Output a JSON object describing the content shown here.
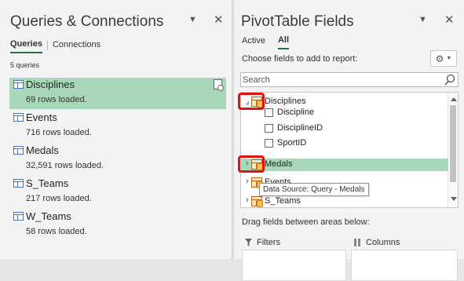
{
  "queries_pane": {
    "title": "Queries & Connections",
    "tabs": [
      "Queries",
      "Connections"
    ],
    "active_tab": "Queries",
    "count_label": "5 queries",
    "items": [
      {
        "name": "Disciplines",
        "rows": "69 rows loaded.",
        "selected": true
      },
      {
        "name": "Events",
        "rows": "716 rows loaded.",
        "selected": false
      },
      {
        "name": "Medals",
        "rows": "32,591 rows loaded.",
        "selected": false
      },
      {
        "name": "S_Teams",
        "rows": "217 rows loaded.",
        "selected": false
      },
      {
        "name": "W_Teams",
        "rows": "58 rows loaded.",
        "selected": false
      }
    ]
  },
  "pivot_pane": {
    "title": "PivotTable Fields",
    "tabs": [
      "Active",
      "All"
    ],
    "active_tab": "All",
    "choose_label": "Choose fields to add to report:",
    "search_placeholder": "Search",
    "tables": {
      "disciplines": {
        "name": "Disciplines",
        "expander": "⌟",
        "fields": [
          "Discipline",
          "DisciplineID",
          "SportID"
        ]
      },
      "medals": {
        "name": "Medals",
        "expander": "›",
        "highlighted": true
      },
      "events": {
        "name": "Events",
        "expander": "›"
      },
      "s_teams": {
        "name": "S_Teams",
        "expander": "›"
      }
    },
    "tooltip": "Data Source: Query - Medals",
    "drag_label": "Drag fields between areas below:",
    "areas": {
      "filters": "Filters",
      "columns": "Columns"
    }
  },
  "colors": {
    "accent": "#217346",
    "selection": "#a8d8b9",
    "annotation": "#e01212"
  },
  "icons": {
    "query": "table-icon",
    "refresh": "refresh-icon",
    "settings": "gear-icon",
    "search": "search-icon",
    "table": "table-database-icon",
    "filter": "filter-icon",
    "columns": "columns-icon"
  }
}
